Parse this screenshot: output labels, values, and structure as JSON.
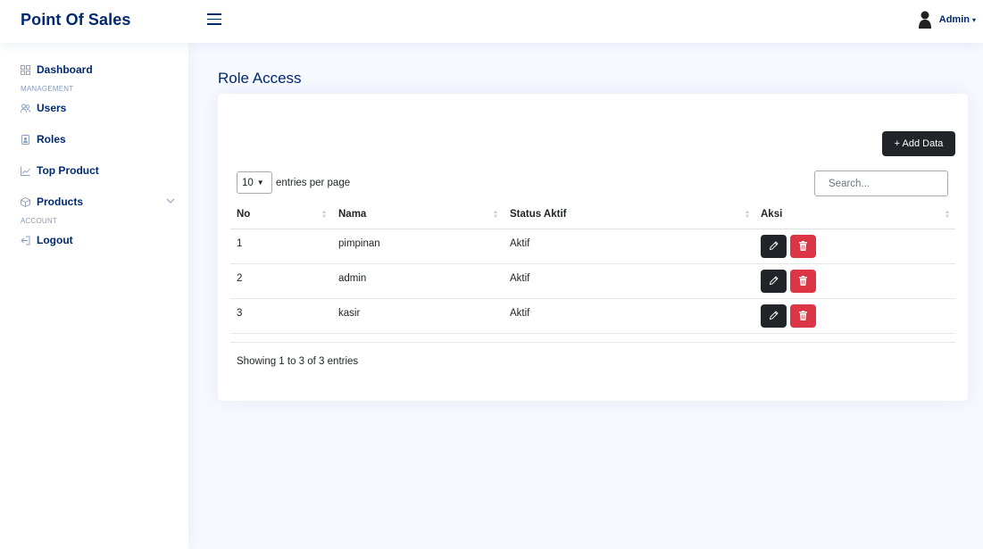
{
  "header": {
    "brand": "Point Of Sales",
    "user_name": "Admin"
  },
  "sidebar": {
    "items": [
      {
        "label": "Dashboard",
        "icon": "grid-icon"
      },
      {
        "heading": "MANAGEMENT"
      },
      {
        "label": "Users",
        "icon": "people-icon"
      },
      {
        "label": "Roles",
        "icon": "person-badge-icon"
      },
      {
        "label": "Top Product",
        "icon": "graph-icon"
      },
      {
        "label": "Products",
        "icon": "box-icon"
      },
      {
        "heading": "ACCOUNT"
      },
      {
        "label": "Logout",
        "icon": "logout-icon"
      }
    ]
  },
  "main": {
    "title": "Role Access",
    "add_button": "+ Add Data",
    "entries_value": "10",
    "entries_label": "entries per page",
    "search_placeholder": "Search...",
    "columns": [
      "No",
      "Nama",
      "Status Aktif",
      "Aksi"
    ],
    "rows": [
      {
        "no": "1",
        "nama": "pimpinan",
        "status": "Aktif"
      },
      {
        "no": "2",
        "nama": "admin",
        "status": "Aktif"
      },
      {
        "no": "3",
        "nama": "kasir",
        "status": "Aktif"
      }
    ],
    "info": "Showing 1 to 3 of 3 entries"
  },
  "colors": {
    "primary": "#012970",
    "muted": "#899bbd",
    "dark_button": "#212529",
    "danger": "#dc3545",
    "background": "#f6f9ff"
  }
}
